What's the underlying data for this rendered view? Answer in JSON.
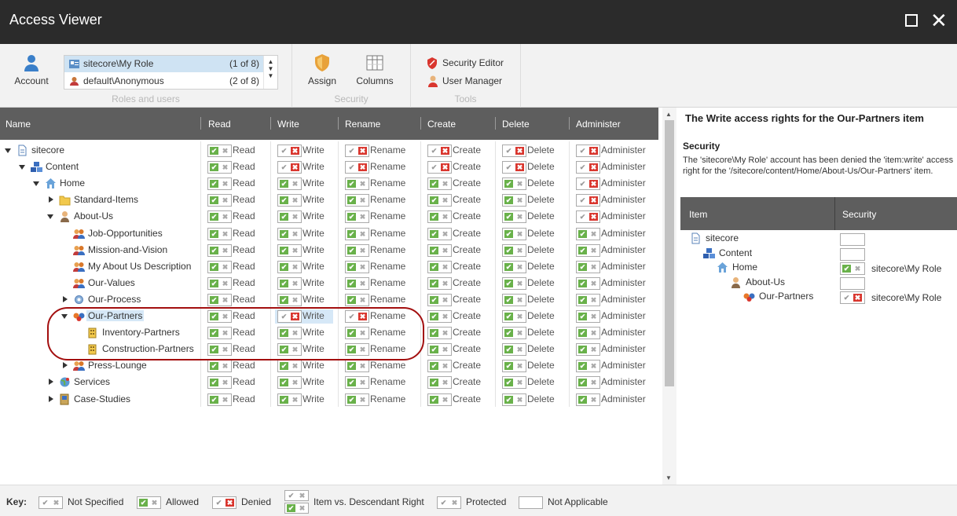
{
  "window": {
    "title": "Access Viewer"
  },
  "ribbon": {
    "account_label": "Account",
    "roles": [
      {
        "name": "sitecore\\My Role",
        "count": "(1 of 8)"
      },
      {
        "name": "default\\Anonymous",
        "count": "(2 of 8)"
      }
    ],
    "roles_group": "Roles and users",
    "assign_label": "Assign",
    "columns_label": "Columns",
    "security_group": "Security",
    "security_editor": "Security Editor",
    "user_manager": "User Manager",
    "tools_group": "Tools"
  },
  "grid": {
    "columns": [
      "Name",
      "Read",
      "Write",
      "Rename",
      "Create",
      "Delete",
      "Administer"
    ],
    "rows": [
      {
        "label": "sitecore",
        "write": "d",
        "rename": "d",
        "create": "d",
        "delete": "d",
        "admin": "d"
      },
      {
        "label": "Content",
        "write": "d",
        "rename": "d",
        "create": "d",
        "delete": "d",
        "admin": "d"
      },
      {
        "label": "Home",
        "write": "a",
        "rename": "a",
        "create": "a",
        "delete": "a",
        "admin": "d"
      },
      {
        "label": "Standard-Items",
        "write": "a",
        "rename": "a",
        "create": "a",
        "delete": "a",
        "admin": "d"
      },
      {
        "label": "About-Us",
        "write": "a",
        "rename": "a",
        "create": "a",
        "delete": "a",
        "admin": "d"
      },
      {
        "label": "Job-Opportunities",
        "write": "a",
        "rename": "a",
        "create": "a",
        "delete": "a",
        "admin": "a"
      },
      {
        "label": "Mission-and-Vision",
        "write": "a",
        "rename": "a",
        "create": "a",
        "delete": "a",
        "admin": "a"
      },
      {
        "label": "My About Us Description",
        "write": "a",
        "rename": "a",
        "create": "a",
        "delete": "a",
        "admin": "a"
      },
      {
        "label": "Our-Values",
        "write": "a",
        "rename": "a",
        "create": "a",
        "delete": "a",
        "admin": "a"
      },
      {
        "label": "Our-Process",
        "write": "a",
        "rename": "a",
        "create": "a",
        "delete": "a",
        "admin": "a"
      },
      {
        "label": "Our-Partners",
        "write": "d",
        "rename": "d",
        "create": "a",
        "delete": "a",
        "admin": "a"
      },
      {
        "label": "Inventory-Partners",
        "write": "a",
        "rename": "a",
        "create": "a",
        "delete": "a",
        "admin": "a"
      },
      {
        "label": "Construction-Partners",
        "write": "a",
        "rename": "a",
        "create": "a",
        "delete": "a",
        "admin": "a"
      },
      {
        "label": "Press-Lounge",
        "write": "a",
        "rename": "a",
        "create": "a",
        "delete": "a",
        "admin": "a"
      },
      {
        "label": "Services",
        "write": "a",
        "rename": "a",
        "create": "a",
        "delete": "a",
        "admin": "a"
      },
      {
        "label": "Case-Studies",
        "write": "a",
        "rename": "a",
        "create": "a",
        "delete": "a",
        "admin": "a"
      }
    ],
    "cell_labels": {
      "read": "Read",
      "write": "Write",
      "rename": "Rename",
      "create": "Create",
      "delete": "Delete",
      "admin": "Administer"
    }
  },
  "panel": {
    "title": "The Write access rights for the Our-Partners item",
    "subtitle": "Security",
    "description": "The 'sitecore\\My Role' account has been denied the 'item:write' access right for the '/sitecore/content/Home/About-Us/Our-Partners' item.",
    "col_item": "Item",
    "col_security": "Security",
    "rows": [
      {
        "label": "sitecore",
        "state": "",
        "account": ""
      },
      {
        "label": "Content",
        "state": "",
        "account": ""
      },
      {
        "label": "Home",
        "state": "a",
        "account": "sitecore\\My Role"
      },
      {
        "label": "About-Us",
        "state": "",
        "account": ""
      },
      {
        "label": "Our-Partners",
        "state": "d",
        "account": "sitecore\\My Role"
      }
    ]
  },
  "footer": {
    "key": "Key:",
    "not_specified": "Not Specified",
    "allowed": "Allowed",
    "denied": "Denied",
    "item_vs_desc": "Item vs. Descendant Right",
    "protected": "Protected",
    "not_applicable": "Not Applicable"
  },
  "colors": {
    "allowed": "#69b14a",
    "denied": "#d9362e",
    "header": "#5e5e5e",
    "titlebar": "#2b2b2b",
    "highlight": "#a30f0f"
  }
}
